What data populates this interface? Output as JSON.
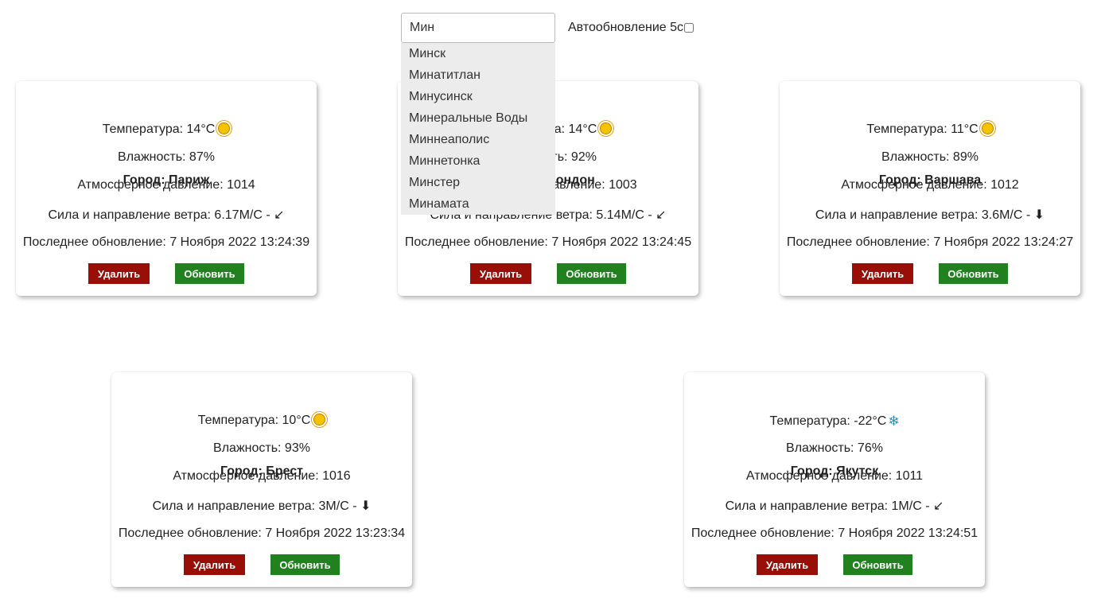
{
  "search": {
    "value": "Мин",
    "placeholder": ""
  },
  "autoupdate": {
    "label": "Автообновление 5с",
    "checked": false
  },
  "suggestions": [
    "Минск",
    "Минатитлан",
    "Минусинск",
    "Минеральные Воды",
    "Миннеаполис",
    "Миннетонка",
    "Минстер",
    "Минамата"
  ],
  "cards": [
    {
      "city": "Город: Париж",
      "temperature": "Температура: 14°C",
      "icon": "sun-icon",
      "humidity": "Влажность: 87%",
      "pressure": "Атмосферное давление: 1014",
      "wind": "Сила и направление ветра: 6.17М/С - ↙",
      "updated": "Последнее обновление: 7 Ноября 2022 13:24:39",
      "delete_label": "Удалить",
      "refresh_label": "Обновить"
    },
    {
      "city": "Город: Лондон",
      "temperature": "Температура: 14°C",
      "icon": "sun-icon",
      "humidity": "Влажность: 92%",
      "pressure": "Атмосферное давление: 1003",
      "wind": "Сила и направление ветра: 5.14М/С - ↙",
      "updated": "Последнее обновление: 7 Ноября 2022 13:24:45",
      "delete_label": "Удалить",
      "refresh_label": "Обновить"
    },
    {
      "city": "Город: Варшава",
      "temperature": "Температура: 11°C",
      "icon": "sun-icon",
      "humidity": "Влажность: 89%",
      "pressure": "Атмосферное давление: 1012",
      "wind": "Сила и направление ветра: 3.6М/С - ⬇",
      "updated": "Последнее обновление: 7 Ноября 2022 13:24:27",
      "delete_label": "Удалить",
      "refresh_label": "Обновить"
    },
    {
      "city": "Город: Брест",
      "temperature": "Температура: 10°C",
      "icon": "sun-icon",
      "humidity": "Влажность: 93%",
      "pressure": "Атмосферное давление: 1016",
      "wind": "Сила и направление ветра: 3М/С - ⬇",
      "updated": "Последнее обновление: 7 Ноября 2022 13:23:34",
      "delete_label": "Удалить",
      "refresh_label": "Обновить"
    },
    {
      "city": "Город: Якутск",
      "temperature": "Температура: -22°C",
      "icon": "snowflake-icon",
      "humidity": "Влажность: 76%",
      "pressure": "Атмосферное давление: 1011",
      "wind": "Сила и направление ветра: 1М/С - ↙",
      "updated": "Последнее обновление: 7 Ноября 2022 13:24:51",
      "delete_label": "Удалить",
      "refresh_label": "Обновить"
    }
  ],
  "colors": {
    "delete_button": "#990e06",
    "refresh_button": "#22811f",
    "dropdown_background": "#ececec"
  }
}
